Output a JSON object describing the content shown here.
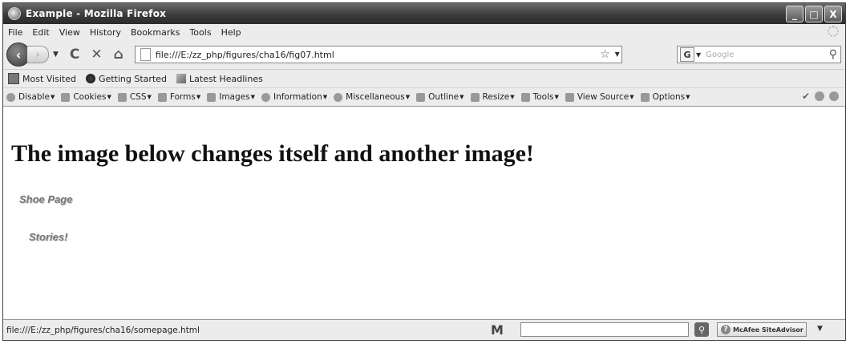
{
  "window": {
    "title": "Example - Mozilla Firefox",
    "controls": [
      "_",
      "□",
      "X"
    ]
  },
  "menu": [
    "File",
    "Edit",
    "View",
    "History",
    "Bookmarks",
    "Tools",
    "Help"
  ],
  "nav": {
    "back_icon": "back-arrow-icon",
    "forward_icon": "forward-arrow-icon",
    "reload_glyph": "C",
    "stop_glyph": "✕",
    "home_glyph": "⌂",
    "url": "file:///E:/zz_php/figures/cha16/fig07.html",
    "search_engine": "G",
    "search_placeholder": "Google"
  },
  "bookmarks": [
    "Most Visited",
    "Getting Started",
    "Latest Headlines"
  ],
  "devtoolbar": [
    "Disable",
    "Cookies",
    "CSS",
    "Forms",
    "Images",
    "Information",
    "Miscellaneous",
    "Outline",
    "Resize",
    "Tools",
    "View Source",
    "Options"
  ],
  "content": {
    "heading": "The image below changes itself and another image!",
    "image_link_1": "Shoe Page",
    "image_link_2": "Stories!"
  },
  "status": {
    "text": "file:///E:/zz_php/figures/cha16/somepage.html",
    "m_logo": "M",
    "siteadvisor": "McAfee SiteAdvisor"
  }
}
